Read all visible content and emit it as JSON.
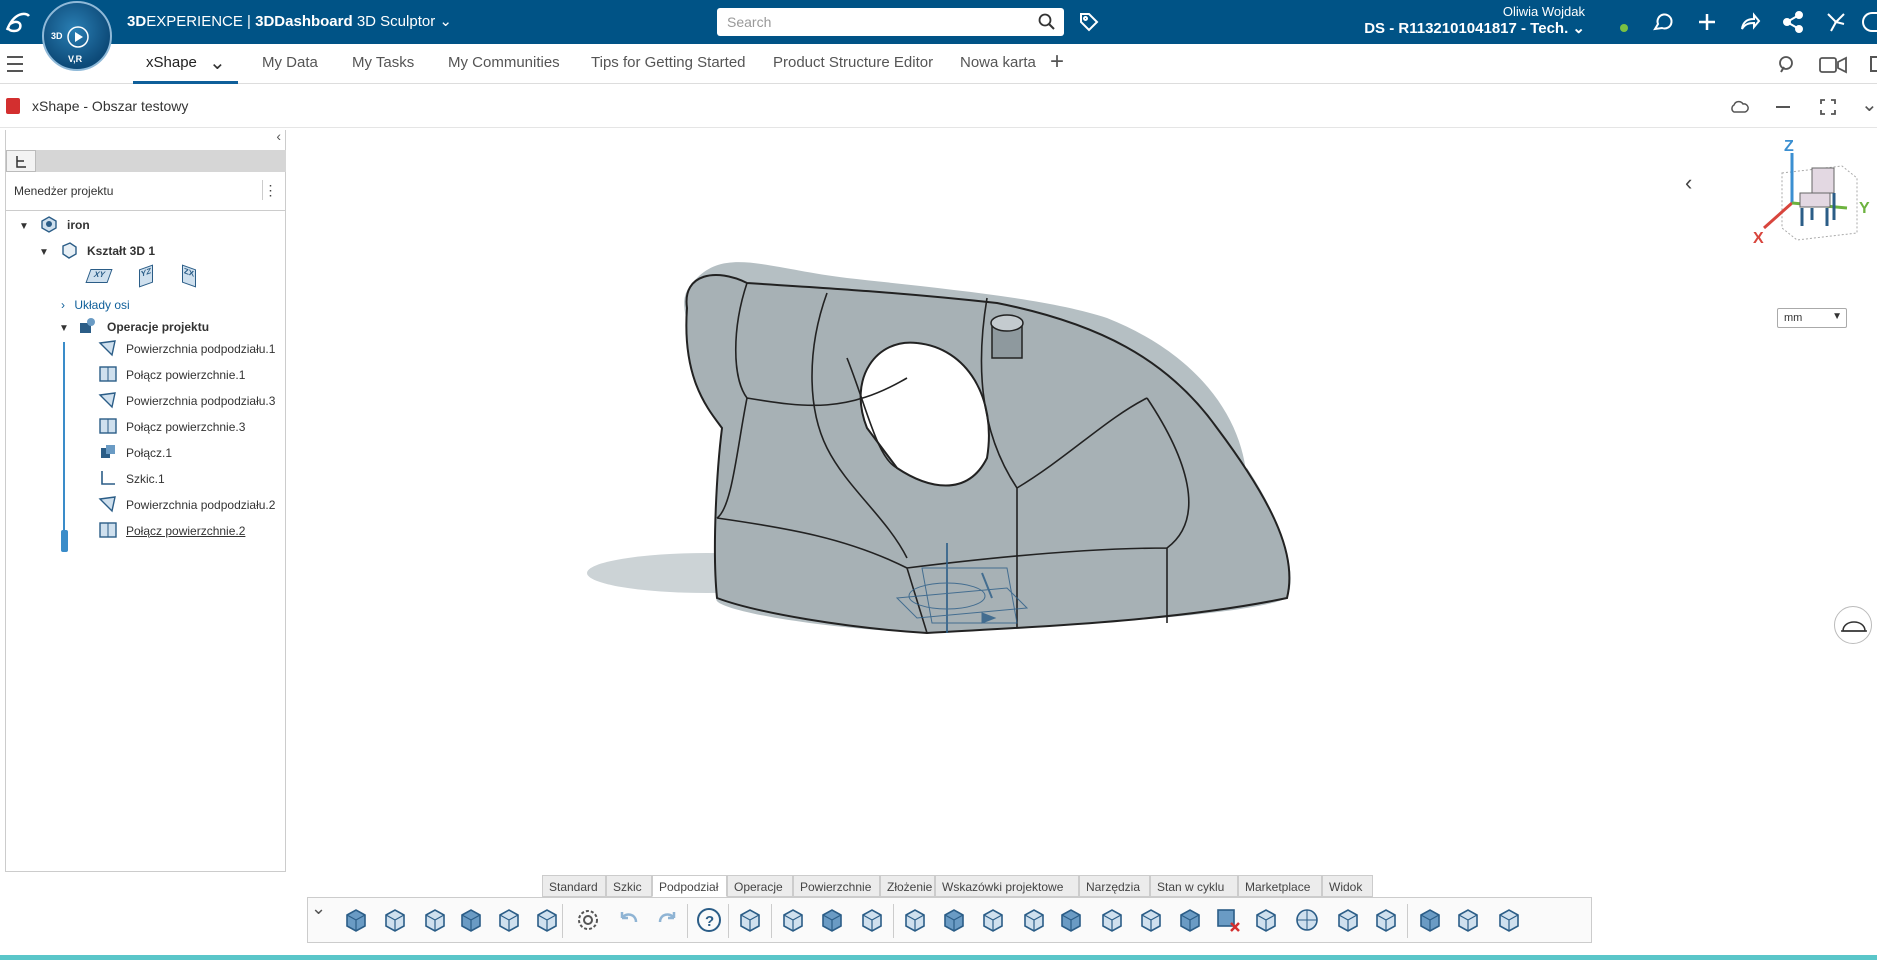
{
  "header": {
    "brand_3d": "3D",
    "brand_exp": "EXPERIENCE",
    "separator": " | ",
    "dashboard": "3DDashboard",
    "app": "3D Sculptor",
    "search_placeholder": "Search",
    "user_name": "Oliwia Wojdak",
    "tenant": "DS - R1132101041817 - Tech.",
    "compass_top": "3D",
    "compass_bottom": "V,R"
  },
  "tabs": [
    {
      "label": "xShape"
    },
    {
      "label": "My Data"
    },
    {
      "label": "My Tasks"
    },
    {
      "label": "My Communities"
    },
    {
      "label": "Tips for Getting Started"
    },
    {
      "label": "Product Structure Editor"
    },
    {
      "label": "Nowa karta"
    }
  ],
  "app_title": "xShape - Obszar testowy",
  "panel": {
    "title": "Menedżer projektu",
    "root": "iron",
    "shape": "Kształt 3D 1",
    "planes": [
      "XY",
      "YZ",
      "ZX"
    ],
    "axes": "Układy osi",
    "ops": "Operacje projektu",
    "ops_items": [
      "Powierzchnia podpodziału.1",
      "Połącz powierzchnie.1",
      "Powierzchnia podpodziału.3",
      "Połącz powierzchnie.3",
      "Połącz.1",
      "Szkic.1",
      "Powierzchnia podpodziału.2",
      "Połącz powierzchnie.2"
    ]
  },
  "compass": {
    "z": "Z",
    "y": "Y",
    "x": "X"
  },
  "units": "mm",
  "bottom_tabs": [
    "Standard",
    "Szkic",
    "Podpodział",
    "Operacje",
    "Powierzchnie",
    "Złożenie",
    "Wskazówki projektowe",
    "Narzędzia",
    "Stan w cyklu",
    "Marketplace",
    "Widok"
  ],
  "colors": {
    "header": "#005386",
    "accent": "#0f5f9a",
    "footer": "#5ac6c9"
  }
}
